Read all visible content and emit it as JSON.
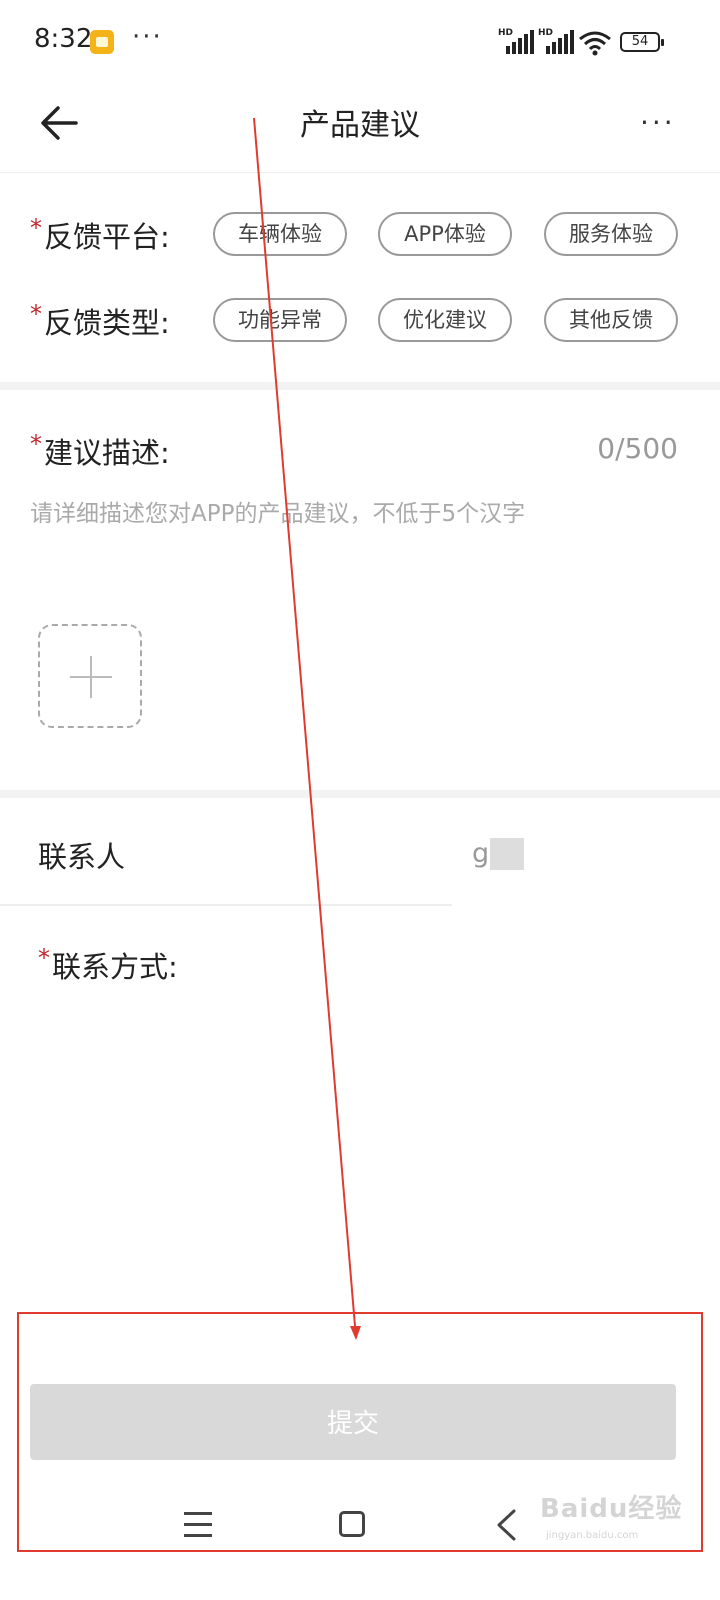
{
  "status_bar": {
    "time": "8:32",
    "more": "···",
    "signal1_label": "HD",
    "signal2_label": "HD",
    "battery": "54"
  },
  "header": {
    "title": "产品建议",
    "back_icon": "arrow-left-icon",
    "more": "···"
  },
  "feedback_platform": {
    "required_mark": "*",
    "label": "反馈平台:",
    "options": [
      "车辆体验",
      "APP体验",
      "服务体验"
    ]
  },
  "feedback_type": {
    "required_mark": "*",
    "label": "反馈类型:",
    "options": [
      "功能异常",
      "优化建议",
      "其他反馈"
    ]
  },
  "description": {
    "required_mark": "*",
    "label": "建议描述:",
    "counter": "0/500",
    "placeholder": "请详细描述您对APP的产品建议，不低于5个汉字"
  },
  "contact": {
    "label": "联系人",
    "value": "g"
  },
  "contact_method": {
    "required_mark": "*",
    "label": "联系方式:"
  },
  "submit_label": "提交",
  "watermark": {
    "text": "Baidu经验",
    "sub": "jingyan.baidu.com"
  },
  "colors": {
    "required": "#c1272d",
    "annotation": "#e03b2e",
    "submit_disabled": "#d9d9d9"
  }
}
